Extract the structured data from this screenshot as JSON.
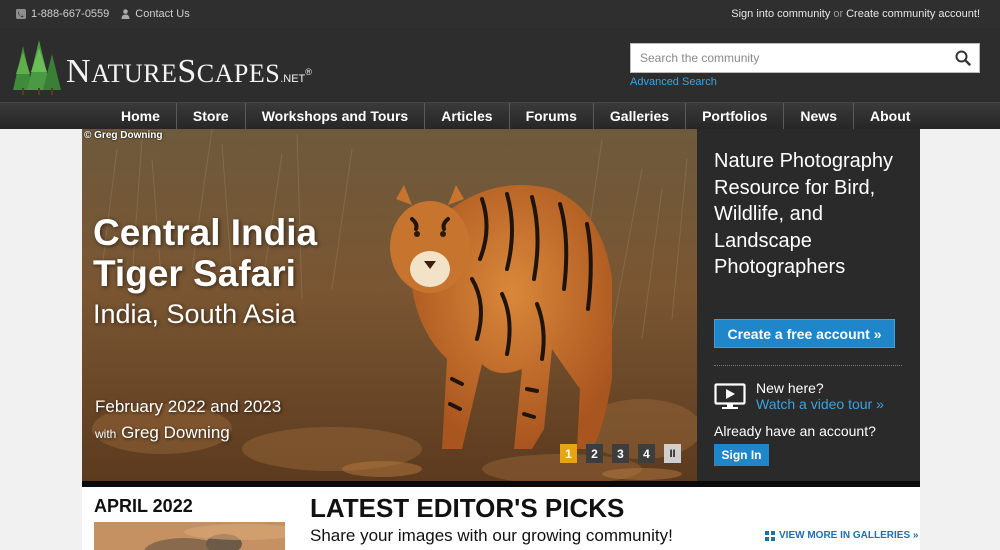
{
  "topbar": {
    "phone": "1-888-667-0559",
    "contact": "Contact Us",
    "signin_community": "Sign into community",
    "or": "or",
    "create_account": "Create community account!"
  },
  "logo": {
    "name": "NatureScapes",
    "first_cap": "N",
    "part1": "ATURE",
    "second_cap": "S",
    "part2": "CAPES",
    "suffix": ".NET",
    "reg": "®"
  },
  "search": {
    "placeholder": "Search the community",
    "advanced": "Advanced Search"
  },
  "nav": {
    "items": [
      "Home",
      "Store",
      "Workshops and Tours",
      "Articles",
      "Forums",
      "Galleries",
      "Portfolios",
      "News",
      "About"
    ]
  },
  "hero": {
    "credit": "© Greg Downing",
    "title_line1": "Central India",
    "title_line2": "Tiger Safari",
    "subtitle": "India, South Asia",
    "dates": "February 2022 and 2023",
    "with_word": "with",
    "with_name": "Greg Downing",
    "pager": [
      "1",
      "2",
      "3",
      "4"
    ],
    "pager_active": 1,
    "pause": "II"
  },
  "panel": {
    "title": "Nature Photography Resource for Bird, Wildlife, and Landscape Photographers",
    "cta": "Create a free account »",
    "new_here": "New here?",
    "video_tour": "Watch a video tour »",
    "already": "Already have an account?",
    "signin": "Sign In"
  },
  "bottom": {
    "month": "APRIL 2022",
    "picks_title": "LATEST EDITOR'S PICKS",
    "picks_sub": "Share your images with our growing community!",
    "view_more": "VIEW MORE IN GALLERIES »"
  },
  "colors": {
    "accent_blue": "#1e86c9",
    "link_blue": "#3ba4e0",
    "pager_active": "#e8a313",
    "dark_panel": "#2a2a2a"
  },
  "icons": [
    "phone-icon",
    "person-icon",
    "search-icon",
    "pine-trees-logo-icon",
    "video-play-icon",
    "grid-icon"
  ]
}
